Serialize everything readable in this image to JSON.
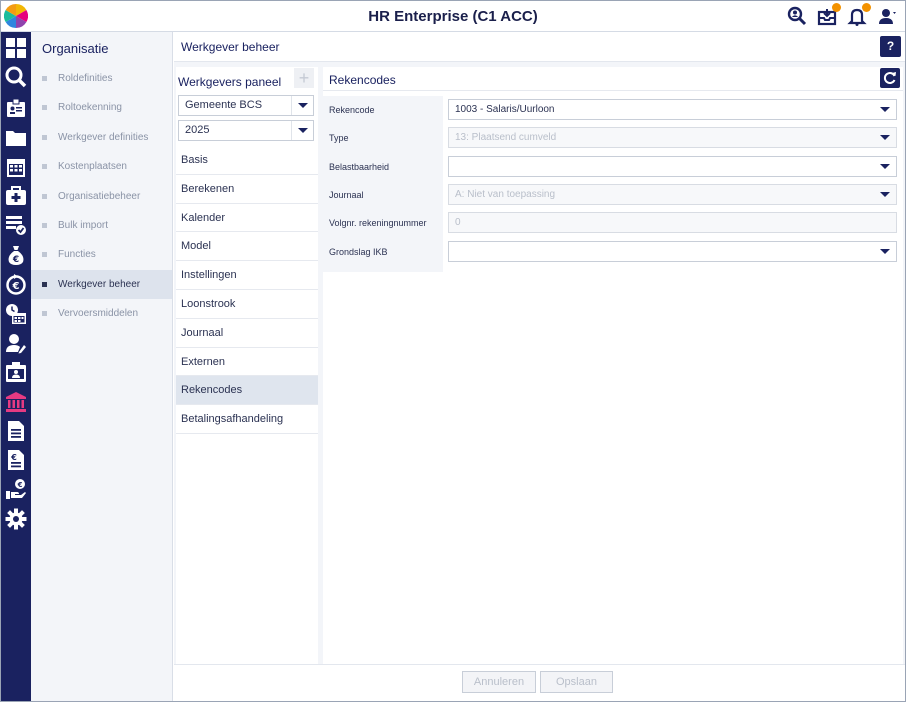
{
  "app": {
    "title": "HR Enterprise (C1 ACC)"
  },
  "topbar": {
    "icons": [
      "search-user-icon",
      "inbox-icon",
      "bell-icon",
      "user-icon"
    ]
  },
  "rail": {
    "icons": [
      "dashboard-icon",
      "search-icon",
      "id-badge-icon",
      "folder-icon",
      "calendar-icon",
      "medical-icon",
      "checklist-icon",
      "money-bag-icon",
      "euro-cycle-icon",
      "schedule-icon",
      "user-edit-icon",
      "contact-card-icon",
      "bank-icon",
      "document-icon",
      "euro-document-icon",
      "hand-coin-icon",
      "gear-icon"
    ],
    "active_index": 12,
    "active_color": "#e63a82"
  },
  "sidebar": {
    "heading": "Organisatie",
    "items": [
      {
        "label": "Roldefinities"
      },
      {
        "label": "Roltoekenning"
      },
      {
        "label": "Werkgever definities"
      },
      {
        "label": "Kostenplaatsen"
      },
      {
        "label": "Organisatiebeheer"
      },
      {
        "label": "Bulk import"
      },
      {
        "label": "Functies"
      },
      {
        "label": "Werkgever beheer"
      },
      {
        "label": "Vervoersmiddelen"
      }
    ],
    "active_index": 7
  },
  "main": {
    "title": "Werkgever beheer",
    "help_label": "?"
  },
  "panel": {
    "title": "Werkgevers paneel",
    "add_label": "+",
    "employer_select": "Gemeente BCS",
    "year_select": "2025",
    "items": [
      {
        "label": "Basis"
      },
      {
        "label": "Berekenen"
      },
      {
        "label": "Kalender"
      },
      {
        "label": "Model"
      },
      {
        "label": "Instellingen"
      },
      {
        "label": "Loonstrook"
      },
      {
        "label": "Journaal"
      },
      {
        "label": "Externen"
      },
      {
        "label": "Rekencodes"
      },
      {
        "label": "Betalingsafhandeling"
      }
    ],
    "active_index": 8
  },
  "detail": {
    "title": "Rekencodes",
    "fields": [
      {
        "label": "Rekencode",
        "value": "1003 - Salaris/Uurloon",
        "disabled": false,
        "select": true
      },
      {
        "label": "Type",
        "value": "13: Plaatsend cumveld",
        "disabled": true,
        "select": true
      },
      {
        "label": "Belastbaarheid",
        "value": "",
        "disabled": false,
        "select": true
      },
      {
        "label": "Journaal",
        "value": "A: Niet van toepassing",
        "disabled": true,
        "select": true
      },
      {
        "label": "Volgnr. rekeningnummer",
        "value": "0",
        "disabled": true,
        "select": false
      },
      {
        "label": "Grondslag IKB",
        "value": "",
        "disabled": false,
        "select": true
      }
    ]
  },
  "footer": {
    "cancel_label": "Annuleren",
    "save_label": "Opslaan"
  },
  "colors": {
    "brand_navy": "#1a2260",
    "notification_badge": "#f39200"
  }
}
